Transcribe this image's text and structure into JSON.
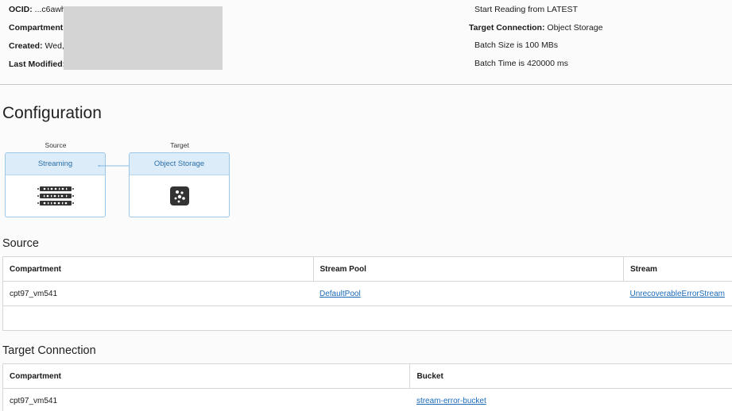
{
  "details": {
    "ocid_label": "OCID:",
    "ocid_value": "...c6awh",
    "compartment_label": "Compartment",
    "created_label": "Created:",
    "created_value": "Wed,",
    "last_modified_label": "Last Modified:",
    "start_reading": "Start Reading from LATEST",
    "target_connection_label": "Target Connection:",
    "target_connection_value": "Object Storage",
    "batch_size": "Batch Size is 100 MBs",
    "batch_time": "Batch Time is 420000 ms"
  },
  "configuration": {
    "title": "Configuration",
    "source_label": "Source",
    "source_node": "Streaming",
    "target_label": "Target",
    "target_node": "Object Storage",
    "source_icon": "streaming-icon",
    "target_icon": "object-storage-icon",
    "accent_color": "#2e6fa7"
  },
  "source_section": {
    "title": "Source",
    "headers": [
      "Compartment",
      "Stream Pool",
      "Stream"
    ],
    "rows": [
      [
        "cpt97_vm541",
        "DefaultPool",
        "UnrecoverableErrorStream"
      ]
    ]
  },
  "target_section": {
    "title": "Target Connection",
    "headers": [
      "Compartment",
      "Bucket"
    ],
    "rows": [
      [
        "cpt97_vm541",
        "stream-error-bucket"
      ]
    ]
  }
}
